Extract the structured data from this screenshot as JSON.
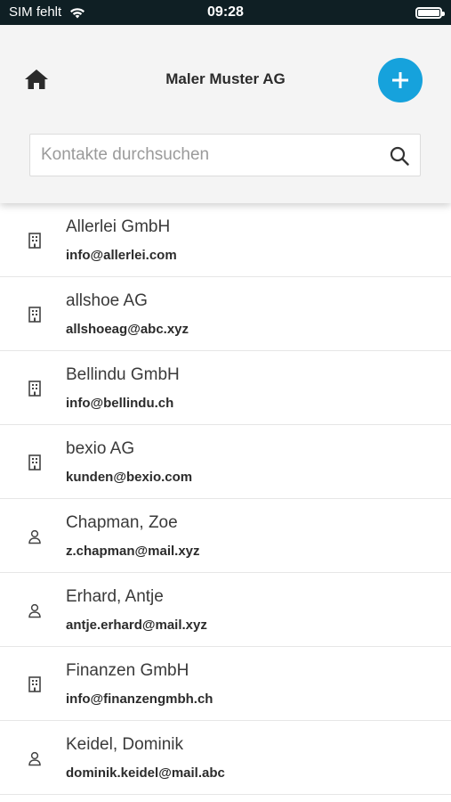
{
  "status_bar": {
    "carrier": "SIM fehlt",
    "time": "09:28"
  },
  "header": {
    "title": "Maler Muster AG",
    "search_placeholder": "Kontakte durchsuchen"
  },
  "colors": {
    "accent": "#16a2dc",
    "header_bg": "#f4f4f4",
    "status_bg": "#0f1f24"
  },
  "contacts": [
    {
      "name": "Allerlei GmbH",
      "email": "info@allerlei.com",
      "type": "company",
      "icon": "building-icon"
    },
    {
      "name": "allshoe AG",
      "email": "allshoeag@abc.xyz",
      "type": "company",
      "icon": "building-icon"
    },
    {
      "name": "Bellindu GmbH",
      "email": "info@bellindu.ch",
      "type": "company",
      "icon": "building-icon"
    },
    {
      "name": "bexio AG",
      "email": "kunden@bexio.com",
      "type": "company",
      "icon": "building-icon"
    },
    {
      "name": "Chapman, Zoe",
      "email": "z.chapman@mail.xyz",
      "type": "person",
      "icon": "person-icon"
    },
    {
      "name": "Erhard, Antje",
      "email": "antje.erhard@mail.xyz",
      "type": "person",
      "icon": "person-icon"
    },
    {
      "name": "Finanzen GmbH",
      "email": "info@finanzengmbh.ch",
      "type": "company",
      "icon": "building-icon"
    },
    {
      "name": "Keidel, Dominik",
      "email": "dominik.keidel@mail.abc",
      "type": "person",
      "icon": "person-icon"
    }
  ]
}
